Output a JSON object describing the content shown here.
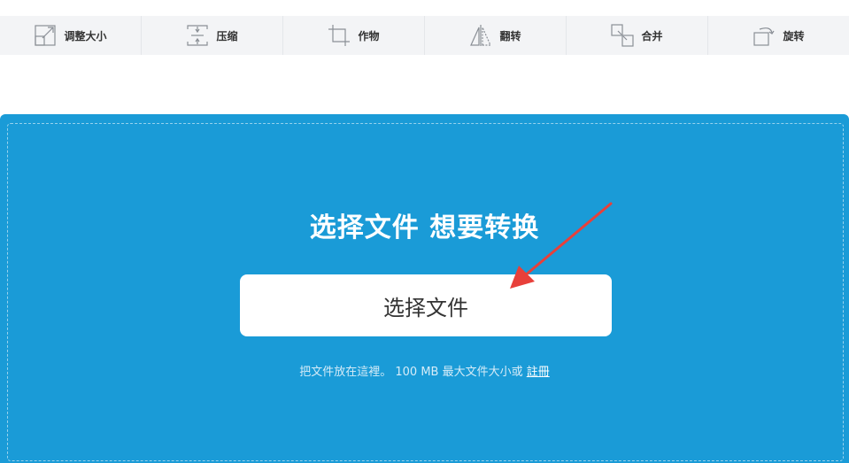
{
  "toolbar": {
    "items": [
      {
        "label": "调整大小",
        "icon": "resize-icon"
      },
      {
        "label": "压缩",
        "icon": "compress-icon"
      },
      {
        "label": "作物",
        "icon": "crop-icon"
      },
      {
        "label": "翻转",
        "icon": "flip-icon"
      },
      {
        "label": "合并",
        "icon": "merge-icon"
      },
      {
        "label": "旋转",
        "icon": "rotate-icon"
      }
    ]
  },
  "upload": {
    "headline": "选择文件 想要转换",
    "button_label": "选择文件",
    "hint_prefix": "把文件放在這裡。 100 MB 最大文件大小或 ",
    "signup_link": "註冊"
  },
  "colors": {
    "panel_bg": "#1a9bd7",
    "toolbar_bg": "#f3f4f6",
    "arrow": "#e8403a"
  }
}
